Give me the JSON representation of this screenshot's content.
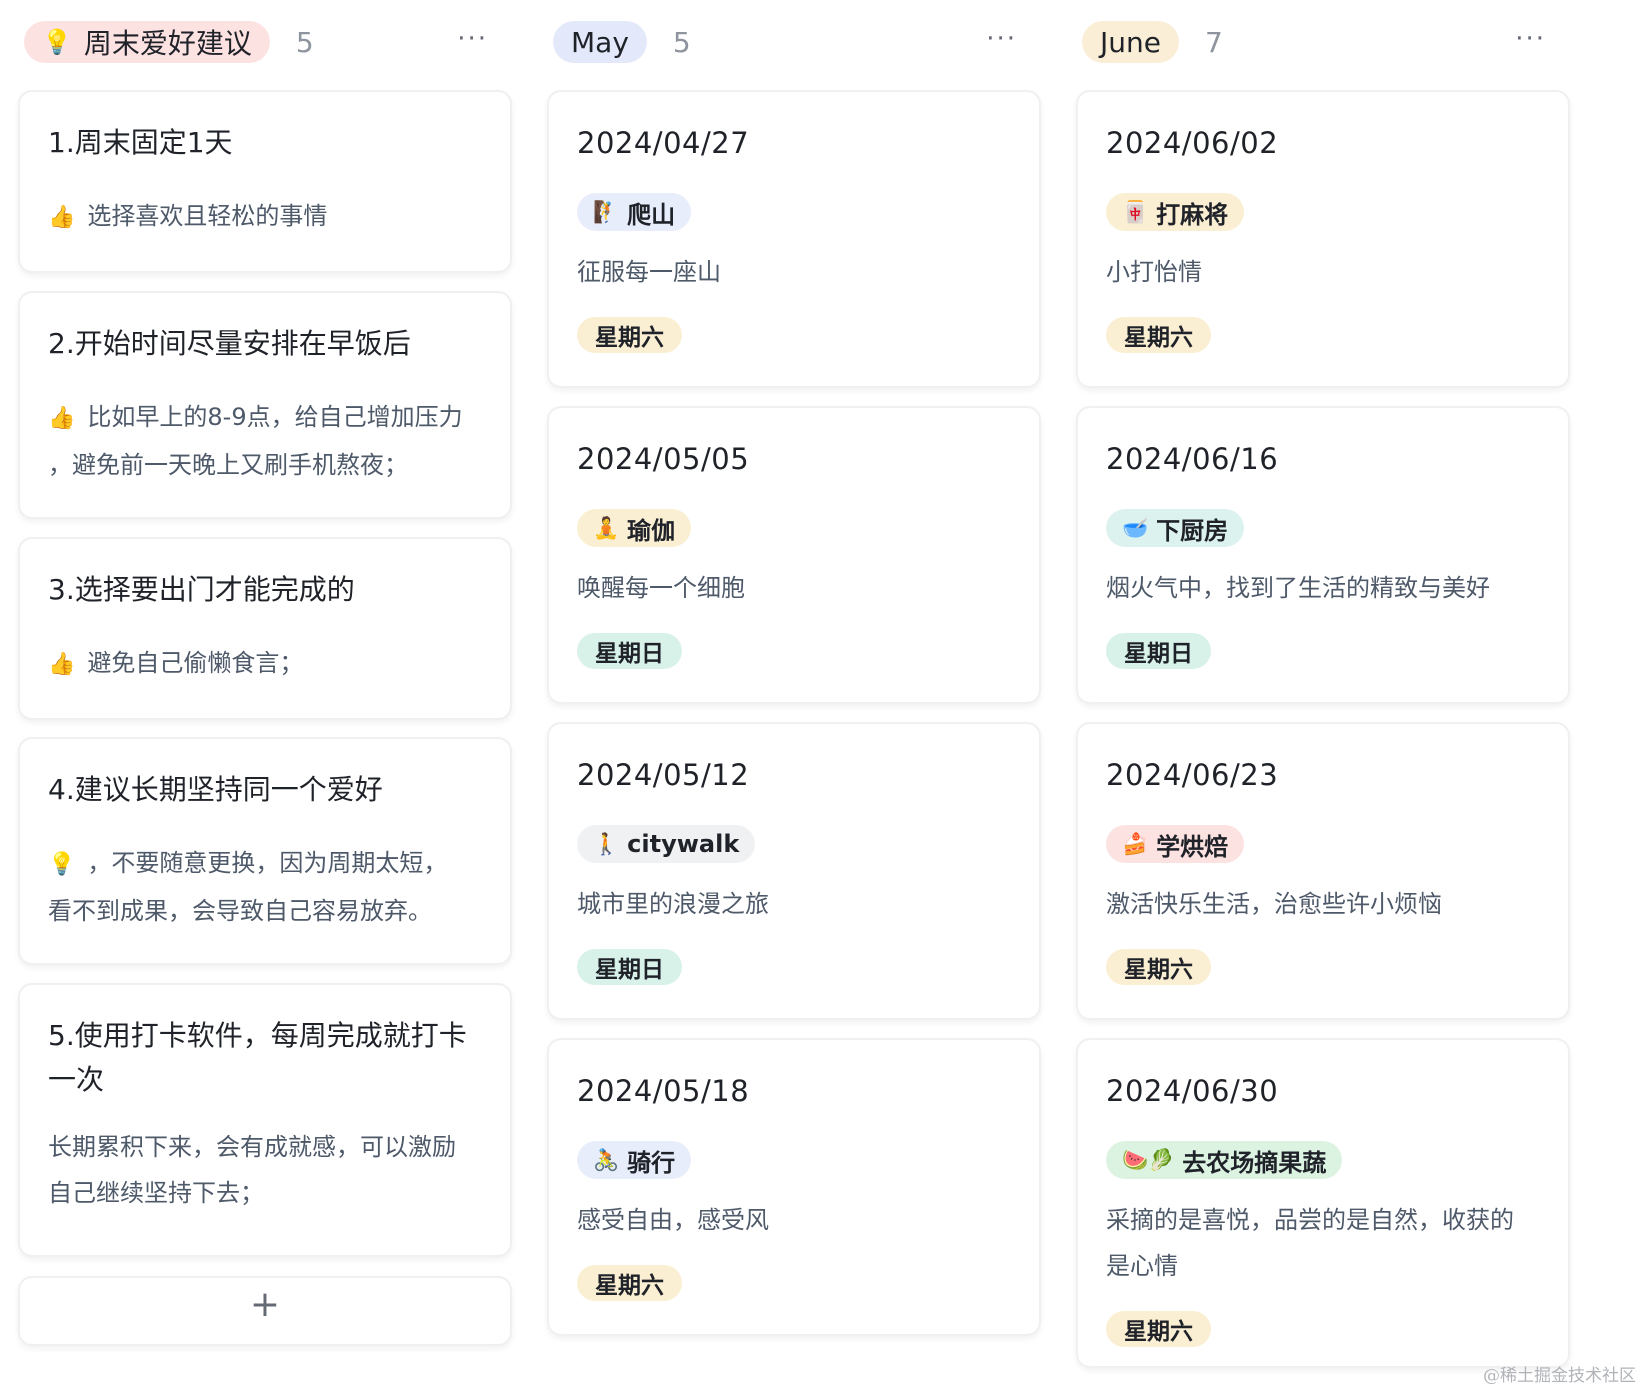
{
  "columns": [
    {
      "title": "周末爱好建议",
      "title_icon": "lightbulb-icon",
      "count": "5",
      "pill_color": "#fde2e2",
      "cards": [
        {
          "title": "1.周末固定1天",
          "body": [
            "选择喜欢且轻松的事情"
          ],
          "lead_icon": "thumbs-up-icon"
        },
        {
          "title": "2.开始时间尽量安排在早饭后",
          "body": [
            "比如早上的8-9点，给自己增加压力",
            "，避免前一天晚上又刷手机熬夜；"
          ],
          "lead_icon": "thumbs-up-icon"
        },
        {
          "title": "3.选择要出门才能完成的",
          "body": [
            "避免自己偷懒食言；"
          ],
          "lead_icon": "thumbs-up-icon"
        },
        {
          "title": "4.建议长期坚持同一个爱好",
          "body": [
            "，不要随意更换，因为周期太短，",
            "看不到成果，会导致自己容易放弃。"
          ],
          "lead_icon": "lightbulb-icon"
        },
        {
          "title": "5.使用打卡软件，每周完成就打卡",
          "title_line2": "一次",
          "body": [
            "长期累积下来，会有成就感，可以激励",
            "自己继续坚持下去；"
          ]
        }
      ],
      "add_label": "+"
    },
    {
      "title": "May",
      "count": "5",
      "pill_color": "#e3e9fb",
      "cards": [
        {
          "date": "2024/04/27",
          "tag": "爬山",
          "tag_icon": "mountain-climbing-icon",
          "tag_color": "#e8edfb",
          "desc": [
            "征服每一座山"
          ],
          "day": "星期六",
          "day_color": "#fbefd3"
        },
        {
          "date": "2024/05/05",
          "tag": "瑜伽",
          "tag_icon": "yoga-icon",
          "tag_color": "#fbefd3",
          "desc": [
            "唤醒每一个细胞"
          ],
          "day": "星期日",
          "day_color": "#d8f2ea"
        },
        {
          "date": "2024/05/12",
          "tag": "citywalk",
          "tag_icon": "walking-icon",
          "tag_color": "#f0f1f3",
          "desc": [
            "城市里的浪漫之旅"
          ],
          "day": "星期日",
          "day_color": "#d8f2ea"
        },
        {
          "date": "2024/05/18",
          "tag": "骑行",
          "tag_icon": "bicycle-icon",
          "tag_color": "#e8edfb",
          "desc": [
            "感受自由，感受风"
          ],
          "day": "星期六",
          "day_color": "#fbefd3"
        }
      ]
    },
    {
      "title": "June",
      "count": "7",
      "pill_color": "#fbeed6",
      "cards": [
        {
          "date": "2024/06/02",
          "tag": "打麻将",
          "tag_icon": "mahjong-icon",
          "tag_color": "#fbefd3",
          "desc": [
            "小打怡情"
          ],
          "day": "星期六",
          "day_color": "#fbefd3"
        },
        {
          "date": "2024/06/16",
          "tag": "下厨房",
          "tag_icon": "cooking-icon",
          "tag_color": "#dcf2ef",
          "desc": [
            "烟火气中，找到了生活的精致与美好"
          ],
          "day": "星期日",
          "day_color": "#d8f2ea"
        },
        {
          "date": "2024/06/23",
          "tag": "学烘焙",
          "tag_icon": "cake-icon",
          "tag_color": "#fde2e2",
          "desc": [
            "激活快乐生活，治愈些许小烦恼"
          ],
          "day": "星期六",
          "day_color": "#fbefd3"
        },
        {
          "date": "2024/06/30",
          "tag": "去农场摘果蔬",
          "tag_icon": "watermelon-leaf-icon",
          "tag_color": "#dcf3e2",
          "desc": [
            "采摘的是喜悦，品尝的是自然，收获的",
            "是心情"
          ],
          "day": "星期六",
          "day_color": "#fbefd3"
        }
      ]
    }
  ],
  "more_label": "···",
  "watermark": "@稀土掘金技术社区"
}
